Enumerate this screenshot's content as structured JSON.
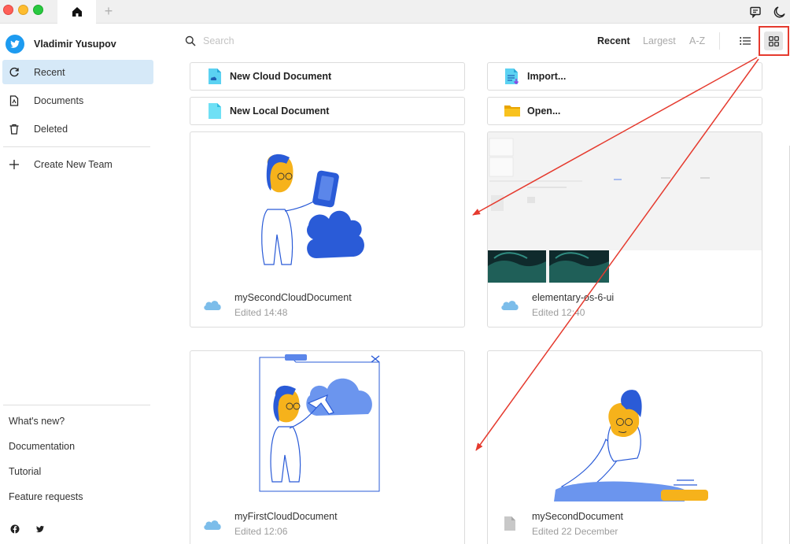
{
  "titlebar": {
    "home_icon": "home-icon",
    "add_tab": "+",
    "right_icons": [
      "feedback-icon",
      "moon-icon"
    ]
  },
  "sidebar": {
    "user_name": "Vladimir Yusupov",
    "nav": [
      {
        "label": "Recent",
        "icon": "refresh-icon",
        "active": true
      },
      {
        "label": "Documents",
        "icon": "document-icon",
        "active": false
      },
      {
        "label": "Deleted",
        "icon": "trash-icon",
        "active": false
      }
    ],
    "create_team": "Create New Team",
    "footer_links": [
      "What's new?",
      "Documentation",
      "Tutorial",
      "Feature requests"
    ],
    "social_icons": [
      "facebook-icon",
      "twitter-icon"
    ]
  },
  "topbar": {
    "search_placeholder": "Search",
    "sort_options": [
      "Recent",
      "Largest",
      "A-Z"
    ],
    "active_sort": "Recent",
    "view_modes": [
      "list-view-icon",
      "grid-view-icon"
    ],
    "active_view": "grid"
  },
  "actions": [
    {
      "label": "New Cloud Document",
      "icon": "cloud-document-icon"
    },
    {
      "label": "Import...",
      "icon": "import-icon"
    },
    {
      "label": "New Local Document",
      "icon": "local-document-icon"
    },
    {
      "label": "Open...",
      "icon": "folder-icon"
    }
  ],
  "documents": [
    {
      "name": "mySecondCloudDocument",
      "edited": "Edited 14:48",
      "storage": "cloud"
    },
    {
      "name": "elementary-os-6-ui",
      "edited": "Edited 12:40",
      "storage": "cloud"
    },
    {
      "name": "myFirstCloudDocument",
      "edited": "Edited 12:06",
      "storage": "cloud"
    },
    {
      "name": "mySecondDocument",
      "edited": "Edited 22 December",
      "storage": "local"
    }
  ],
  "colors": {
    "accent_active": "#d6e9f8",
    "annotation_red": "#e53a2e",
    "cloud_blue": "#7cbdea",
    "illustration_blue": "#2a5bd7",
    "illustration_yellow": "#f6b21b"
  }
}
